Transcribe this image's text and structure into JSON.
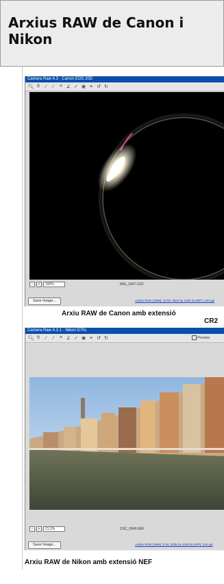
{
  "page": {
    "title": "Arxius RAW de Canon i Nikon"
  },
  "canon": {
    "titlebar": "Camera Raw 4.3  -  Canon EOS 20D",
    "zoom": "100%",
    "filename": "IMG_3347.CR2",
    "save_label": "Save Image...",
    "info": "Adobe RGB (1998); 16 bit; 3504 by 2336 (8.2MP); 240 ppi",
    "caption_line1": "Arxiu RAW de Canon amb extensió",
    "caption_line2": "CR2"
  },
  "nikon": {
    "titlebar": "Camera Raw 4.3.1  -  Nikon D70s",
    "zoom": "21,2%",
    "preview_label": "Preview",
    "filename": "DSC_0049.NEF",
    "save_label": "Save Image...",
    "info": "Adobe RGB (1998); 8 bit; 3008 by 2000 (6.0MP); 240 ppi",
    "caption": "Arxiu RAW de Nikon amb extensió NEF"
  },
  "toolbar_icons": [
    "zoom-icon",
    "hand-icon",
    "white-balance-icon",
    "color-sampler-icon",
    "crop-icon",
    "straighten-icon",
    "retouch-icon",
    "red-eye-icon",
    "preferences-icon",
    "rotate-left-icon",
    "rotate-right-icon"
  ]
}
